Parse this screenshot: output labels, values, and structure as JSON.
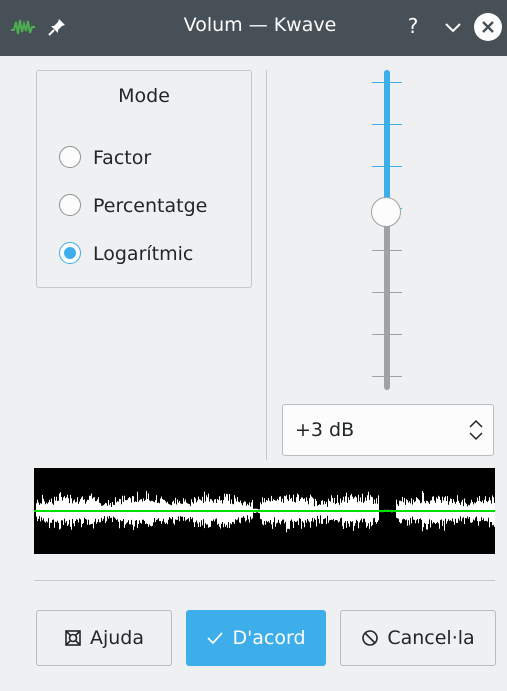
{
  "window": {
    "title": "Volum — Kwave",
    "help_glyph": "?",
    "icons": {
      "app": "kwave-app-icon",
      "pin": "pin-icon",
      "minimize": "chevron-down-icon",
      "close": "close-icon"
    }
  },
  "mode": {
    "title": "Mode",
    "options": [
      {
        "label": "Factor",
        "checked": false
      },
      {
        "label": "Percentatge",
        "checked": false
      },
      {
        "label": "Logarítmic",
        "checked": true
      }
    ]
  },
  "slider": {
    "level_fraction": 0.44,
    "accent": "#3daee9"
  },
  "spinbox": {
    "value": "+3 dB",
    "icon": "up-down-arrows-icon"
  },
  "waveform": {
    "background": "#000000",
    "line_color": "#00e000"
  },
  "buttons": {
    "help": {
      "label": "Ajuda",
      "icon": "lifebuoy-icon"
    },
    "ok": {
      "label": "D'acord",
      "icon": "checkmark-icon"
    },
    "cancel": {
      "label": "Cancel·la",
      "icon": "cancel-icon"
    }
  }
}
